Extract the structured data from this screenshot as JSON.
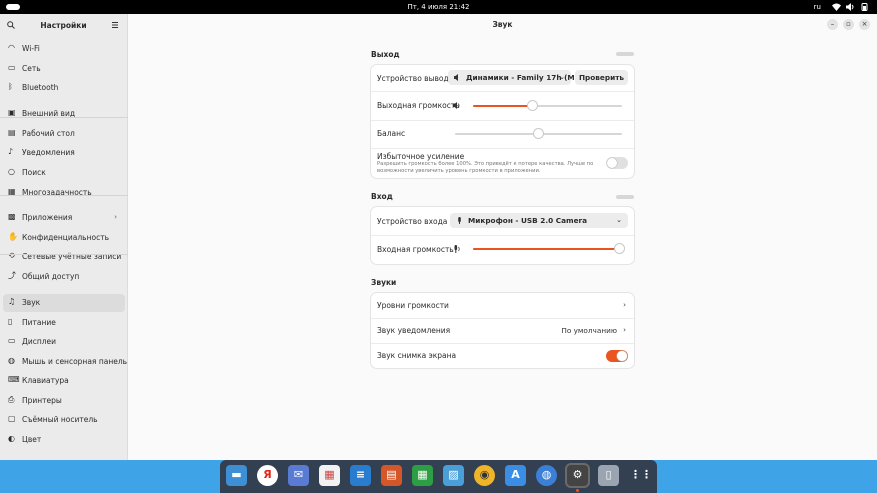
{
  "topbar": {
    "clock": "Пт, 4 июля  21:42",
    "lang": "ru"
  },
  "sidebar": {
    "title": "Настройки",
    "items": [
      {
        "label": "Wi-Fi",
        "icon": "wifi-icon"
      },
      {
        "label": "Сеть",
        "icon": "network-icon"
      },
      {
        "label": "Bluetooth",
        "icon": "bluetooth-icon"
      },
      {
        "label": "Внешний вид",
        "icon": "appearance-icon"
      },
      {
        "label": "Рабочий стол",
        "icon": "desktop-icon"
      },
      {
        "label": "Уведомления",
        "icon": "bell-icon"
      },
      {
        "label": "Поиск",
        "icon": "search-icon"
      },
      {
        "label": "Многозадачность",
        "icon": "multitasking-icon"
      },
      {
        "label": "Приложения",
        "icon": "apps-icon",
        "chevron": "›"
      },
      {
        "label": "Конфиденциальность",
        "icon": "privacy-icon"
      },
      {
        "label": "Сетевые учётные записи",
        "icon": "accounts-icon"
      },
      {
        "label": "Общий доступ",
        "icon": "sharing-icon"
      },
      {
        "label": "Звук",
        "icon": "music-note-icon",
        "active": true
      },
      {
        "label": "Питание",
        "icon": "power-icon"
      },
      {
        "label": "Дисплеи",
        "icon": "display-icon"
      },
      {
        "label": "Мышь и сенсорная панель",
        "icon": "mouse-icon"
      },
      {
        "label": "Клавиатура",
        "icon": "keyboard-icon"
      },
      {
        "label": "Принтеры",
        "icon": "printer-icon"
      },
      {
        "label": "Съёмный носитель",
        "icon": "removable-media-icon"
      },
      {
        "label": "Цвет",
        "icon": "color-icon"
      }
    ]
  },
  "main": {
    "title": "Звук",
    "output": {
      "title": "Выход",
      "device_label": "Устройство вывода",
      "device_value": "Динамики - Family 17h (M...",
      "test_button": "Проверить",
      "volume_label": "Выходная громкость",
      "volume_level": 0.4,
      "balance_label": "Баланс",
      "balance_level": 0.5,
      "overamp_label": "Избыточное усиление",
      "overamp_desc": "Разрешить громкость более 100%. Это приведёт к потере качества. Лучше  по возможности увеличить уровень громкости в приложении.",
      "overamp_on": false
    },
    "input": {
      "title": "Вход",
      "device_label": "Устройство входа",
      "device_value": "Микрофон - USB 2.0 Camera",
      "volume_label": "Входная громкость",
      "volume_level": 0.98
    },
    "sounds": {
      "title": "Звуки",
      "levels_label": "Уровни громкости",
      "alert_label": "Звук уведомления",
      "alert_value": "По умолчанию",
      "screenshot_label": "Звук снимка экрана",
      "screenshot_on": true
    }
  },
  "colors": {
    "accent": "#e95420",
    "dock_bg": "#3fa3e8"
  },
  "dock": [
    "files-icon",
    "yandex-browser-icon",
    "mail-icon",
    "calendar-icon",
    "writer-icon",
    "impress-icon",
    "calc-icon",
    "image-viewer-icon",
    "rhythmbox-icon",
    "app-center-icon",
    "globe-icon",
    "settings-icon",
    "trash-icon",
    "show-apps-icon"
  ]
}
